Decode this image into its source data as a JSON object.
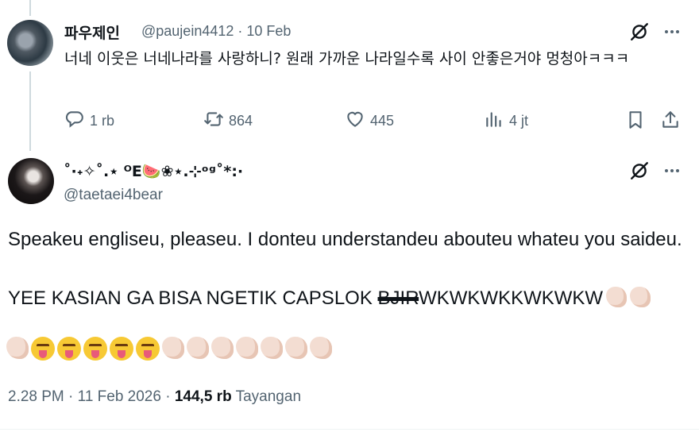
{
  "reply": {
    "author_name": "파우제인",
    "handle": "@paujein4412",
    "separator": "·",
    "date": "10 Feb",
    "text": "너네 이웃은 너네나라를 사랑하니? 원래 가까운 나라일수록 사이 안좋은거야 멍청아ㅋㅋㅋ",
    "reply_count": "1 rb",
    "repost_count": "864",
    "like_count": "445",
    "view_count": "4 jt"
  },
  "main_tweet": {
    "author_name": "˚·˖✧˚.⋆ ᴼE🍉❀⋆.⊹ᵒᵍ˚*:·",
    "handle": "@taetaei4bear",
    "text_line1": "Speakeu engliseu, pleaseu. I donteu understandeu abouteu whateu you saideu.",
    "caps_prefix": "YEE KASIAN GA BISA NGETIK CAPSLOK ",
    "caps_struck": "BJIR",
    "caps_suffix": "WKWKWKKWKWKW",
    "time": "2.28 PM",
    "separator": "·",
    "date": "11 Feb 2026",
    "views": "144,5 rb",
    "views_label": "Tayangan"
  },
  "icons": [
    "grok-icon",
    "more-icon",
    "reply-icon",
    "repost-icon",
    "like-icon",
    "views-icon",
    "bookmark-icon",
    "share-icon"
  ]
}
